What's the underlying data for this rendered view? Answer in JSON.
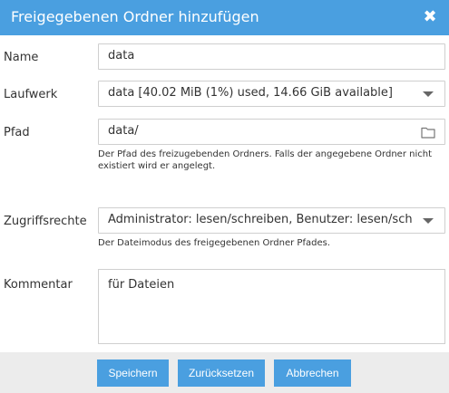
{
  "dialog": {
    "title": "Freigegebenen Ordner hinzufügen",
    "close_icon": "close-icon"
  },
  "fields": {
    "name": {
      "label": "Name",
      "value": "data"
    },
    "drive": {
      "label": "Laufwerk",
      "value": "data [40.02 MiB (1%) used, 14.66 GiB available]"
    },
    "path": {
      "label": "Pfad",
      "value": "data/",
      "help": "Der Pfad des freizugebenden Ordners. Falls der angegebene Ordner nicht existiert wird er angelegt.",
      "icon": "folder-icon"
    },
    "permissions": {
      "label": "Zugriffsrechte",
      "value": "Administrator: lesen/schreiben, Benutzer: lesen/schrei",
      "help": "Der Dateimodus des freigegebenen Ordner Pfades."
    },
    "comment": {
      "label": "Kommentar",
      "value": "für Dateien"
    }
  },
  "buttons": {
    "save": "Speichern",
    "reset": "Zurücksetzen",
    "cancel": "Abbrechen"
  },
  "colors": {
    "accent": "#4a9fe0",
    "footer_bg": "#ececec",
    "border": "#cfcfcf"
  }
}
